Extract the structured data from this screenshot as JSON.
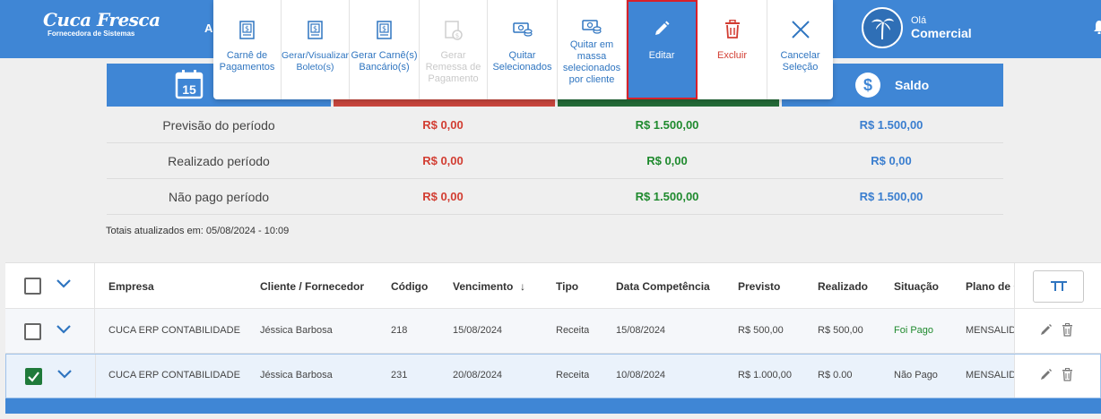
{
  "header": {
    "logo_brand": "Cuca Fresca",
    "logo_sub": "Fornecedora de Sistemas",
    "nav_cut": "A",
    "greeting": "Olá",
    "user_name": "Comercial"
  },
  "toolbar": {
    "buttons": [
      {
        "label": "Carnê de Pagamentos",
        "icon": "document-icon",
        "enabled": true
      },
      {
        "label": "Gerar/Visualizar Boleto(s)",
        "icon": "document-icon",
        "enabled": true
      },
      {
        "label": "Gerar Carnê(s) Bancário(s)",
        "icon": "document-icon",
        "enabled": true
      },
      {
        "label": "Gerar Remessa de Pagamento",
        "icon": "document-money-icon",
        "enabled": false
      },
      {
        "label": "Quitar Selecionados",
        "icon": "money-icon",
        "enabled": true
      },
      {
        "label": "Quitar em massa selecionados por cliente",
        "icon": "money-icon",
        "enabled": true
      },
      {
        "label": "Editar",
        "icon": "pencil-icon",
        "enabled": true,
        "highlighted": true
      },
      {
        "label": "Excluir",
        "icon": "trash-icon",
        "enabled": true
      },
      {
        "label": "Cancelar Seleção",
        "icon": "close-icon",
        "enabled": true
      }
    ]
  },
  "cards": {
    "calendar_day": "15",
    "saldo_label": "Saldo"
  },
  "summary": {
    "rows": [
      {
        "label": "Previsão do período",
        "v1": "R$ 0,00",
        "v2": "R$ 1.500,00",
        "v3": "R$ 1.500,00"
      },
      {
        "label": "Realizado período",
        "v1": "R$ 0,00",
        "v2": "R$ 0,00",
        "v3": "R$ 0,00"
      },
      {
        "label": "Não pago período",
        "v1": "R$ 0,00",
        "v2": "R$ 1.500,00",
        "v3": "R$ 1.500,00"
      }
    ],
    "totals_updated": "Totais atualizados em: 05/08/2024 - 10:09"
  },
  "table": {
    "columns": [
      "Empresa",
      "Cliente / Fornecedor",
      "Código",
      "Vencimento",
      "Tipo",
      "Data Competência",
      "Previsto",
      "Realizado",
      "Situação",
      "Plano de C"
    ],
    "sort_indicator": "↓",
    "rows": [
      {
        "checked": false,
        "empresa": "CUCA ERP CONTABILIDADE",
        "cliente": "Jéssica Barbosa",
        "codigo": "218",
        "vencimento": "15/08/2024",
        "tipo": "Receita",
        "competencia": "15/08/2024",
        "previsto": "R$ 500,00",
        "realizado": "R$ 500,00",
        "situacao": "Foi Pago",
        "plano": "MENSALIDADE"
      },
      {
        "checked": true,
        "empresa": "CUCA ERP CONTABILIDADE",
        "cliente": "Jéssica Barbosa",
        "codigo": "231",
        "vencimento": "20/08/2024",
        "tipo": "Receita",
        "competencia": "10/08/2024",
        "previsto": "R$ 1.000,00",
        "realizado": "R$ 0.00",
        "situacao": "Não Pago",
        "plano": "MENSALIDADE"
      }
    ]
  },
  "colors": {
    "primary": "#3f86d5",
    "danger": "#d23d32",
    "success": "#1f8a2e",
    "dark_green": "#246b38"
  }
}
